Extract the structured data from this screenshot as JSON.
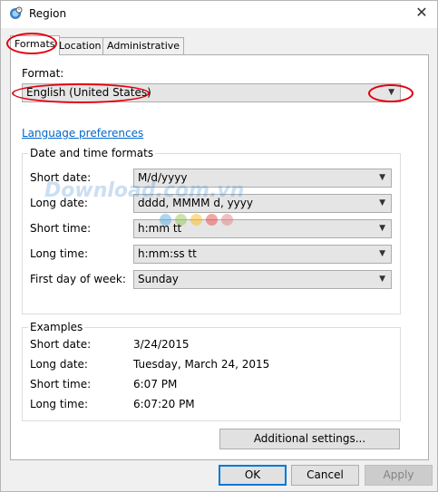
{
  "window": {
    "title": "Region",
    "close_glyph": "✕"
  },
  "tabs": [
    {
      "label": "Formats",
      "active": true
    },
    {
      "label": "Location",
      "active": false
    },
    {
      "label": "Administrative",
      "active": false
    }
  ],
  "format": {
    "label": "Format:",
    "value": "English (United States)",
    "link": "Language preferences"
  },
  "datetime": {
    "title": "Date and time formats",
    "rows": [
      {
        "label": "Short date:",
        "value": "M/d/yyyy"
      },
      {
        "label": "Long date:",
        "value": "dddd, MMMM d, yyyy"
      },
      {
        "label": "Short time:",
        "value": "h:mm tt"
      },
      {
        "label": "Long time:",
        "value": "h:mm:ss tt"
      },
      {
        "label": "First day of week:",
        "value": "Sunday"
      }
    ]
  },
  "examples": {
    "title": "Examples",
    "rows": [
      {
        "label": "Short date:",
        "value": "3/24/2015"
      },
      {
        "label": "Long date:",
        "value": "Tuesday, March 24, 2015"
      },
      {
        "label": "Short time:",
        "value": "6:07 PM"
      },
      {
        "label": "Long time:",
        "value": "6:07:20 PM"
      }
    ]
  },
  "buttons": {
    "additional": "Additional settings...",
    "ok": "OK",
    "cancel": "Cancel",
    "apply": "Apply"
  },
  "watermark": {
    "text": "Download.com.vn"
  },
  "colors": {
    "accent": "#0078d7",
    "link": "#0066cc",
    "highlight_oval": "#e3000f"
  }
}
